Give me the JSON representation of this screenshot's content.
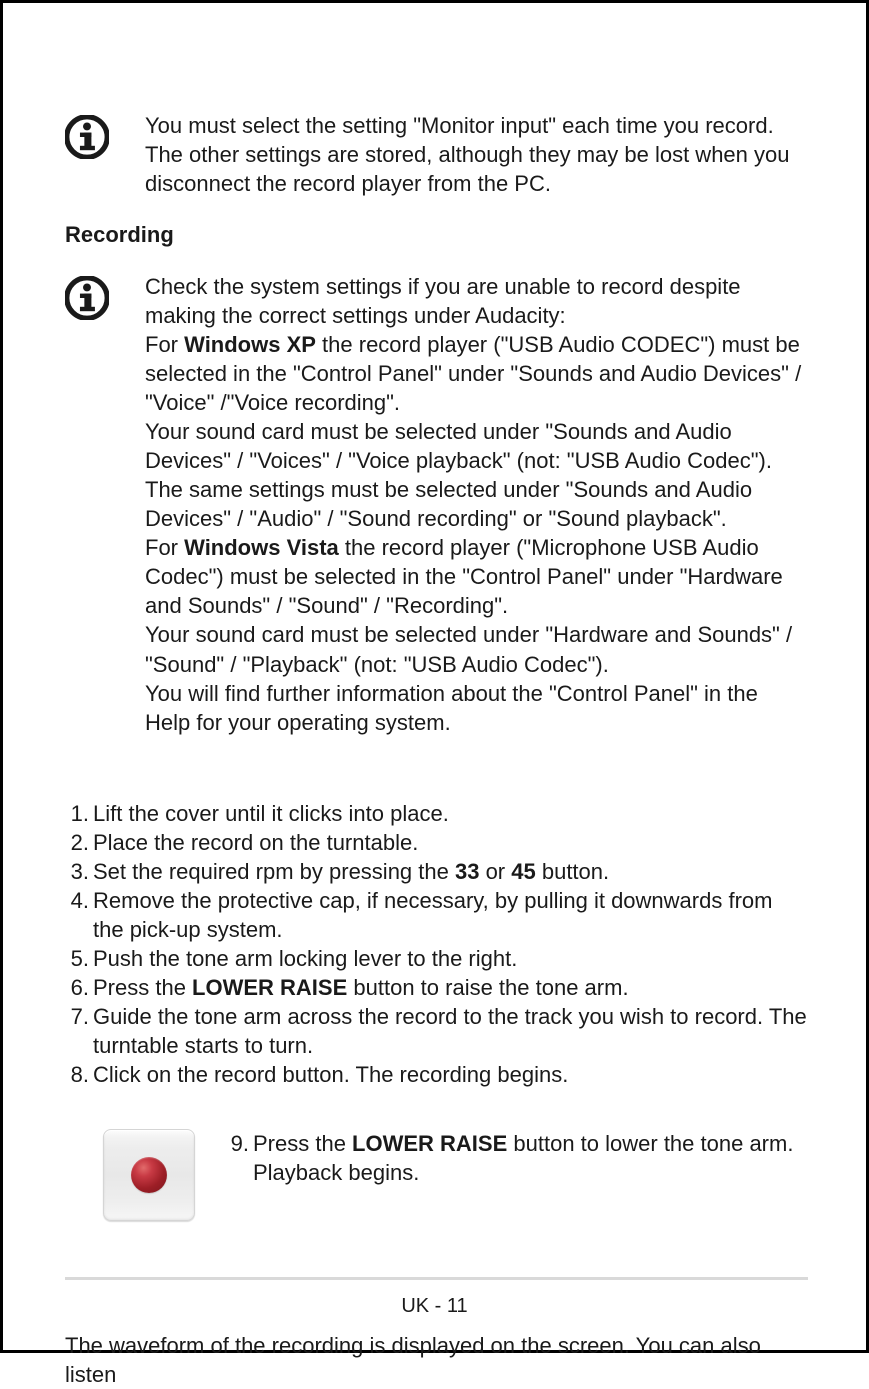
{
  "notes": {
    "note1": "You must select the setting \"Monitor input\" each time you record. The other settings are stored, although they may be lost when you disconnect the record player from the PC.",
    "note2_intro": "Check the system settings if you are unable to record despite making the correct settings under Audacity:",
    "note2_xp_pre": "For ",
    "note2_xp_bold": "Windows XP",
    "note2_xp_post": " the record player (\"USB Audio CODEC\") must be selected in the \"Control Panel\" under \"Sounds and Audio Devices\" / \"Voice\" /\"Voice recording\".",
    "note2_xp2": "Your sound card must be selected under \"Sounds and Audio Devices\" / \"Voices\" / \"Voice playback\" (not: \"USB Audio Codec\").",
    "note2_xp3": "The same settings must be selected under \"Sounds and Audio Devices\" / \"Audio\" / \"Sound recording\" or \"Sound playback\".",
    "note2_vista_pre": "For ",
    "note2_vista_bold": "Windows Vista",
    "note2_vista_post": " the record player (\"Microphone USB Audio Codec\") must be selected in the \"Control Panel\" under \"Hardware and Sounds\" / \"Sound\" / \"Recording\".",
    "note2_vista2": "Your sound card must be selected under \"Hardware and Sounds\" / \"Sound\" / \"Playback\" (not: \"USB Audio Codec\").",
    "note2_help": "You will find further information about the \"Control Panel\" in the Help for your operating system."
  },
  "heading": "Recording",
  "steps": {
    "s1": {
      "n": "1.",
      "t": "Lift the cover until it clicks into place."
    },
    "s2": {
      "n": "2.",
      "t": "Place the record on the turntable."
    },
    "s3": {
      "n": "3.",
      "pre": "Set the required rpm by pressing the ",
      "b1": "33",
      "mid": " or ",
      "b2": "45",
      "post": " button."
    },
    "s4": {
      "n": "4.",
      "t": "Remove the protective cap, if necessary, by pulling it downwards from the pick-up system."
    },
    "s5": {
      "n": "5.",
      "t": "Push the tone arm locking lever to the right."
    },
    "s6": {
      "n": "6.",
      "pre": "Press the ",
      "b": "LOWER RAISE",
      "post": " button to raise the tone arm."
    },
    "s7": {
      "n": "7.",
      "t": "Guide the tone arm across the record to the track you wish to record. The turntable starts to turn."
    },
    "s8": {
      "n": "8.",
      "t": "Click on the record button. The recording begins."
    },
    "s9": {
      "n": "9.",
      "pre": "Press the ",
      "b": "LOWER RAISE",
      "post": " button to lower the tone arm. Playback begins."
    }
  },
  "waveform": "The waveform of the recording is displayed on the screen. You can also listen",
  "footer": {
    "page": "UK - 11"
  }
}
